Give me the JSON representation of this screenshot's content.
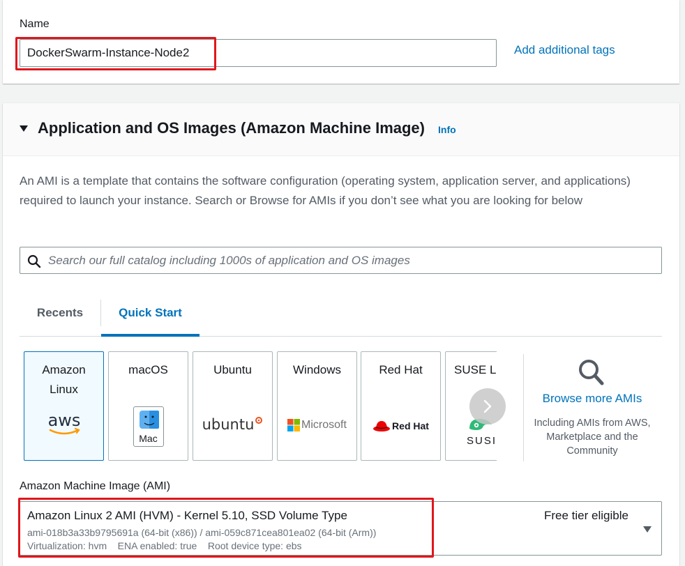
{
  "name_section": {
    "label": "Name",
    "input_value": "DockerSwarm-Instance-Node2",
    "add_tags_link": "Add additional tags"
  },
  "ami_section": {
    "title": "Application and OS Images (Amazon Machine Image)",
    "info_link": "Info",
    "description": "An AMI is a template that contains the software configuration (operating system, application server, and applications) required to launch your instance. Search or Browse for AMIs if you don’t see what you are looking for below",
    "search_placeholder": "Search our full catalog including 1000s of application and OS images",
    "tabs": [
      {
        "label": "Recents",
        "active": false
      },
      {
        "label": "Quick Start",
        "active": true
      }
    ],
    "os_tiles": [
      {
        "label": "Amazon Linux",
        "logo": "aws",
        "selected": true
      },
      {
        "label": "macOS",
        "logo": "Mac",
        "selected": false
      },
      {
        "label": "Ubuntu",
        "logo": "ubuntu",
        "selected": false
      },
      {
        "label": "Windows",
        "logo": "Microsoft",
        "selected": false
      },
      {
        "label": "Red Hat",
        "logo": "Red Hat",
        "selected": false
      },
      {
        "label": "SUSE Li",
        "logo": "SUSI",
        "selected": false
      }
    ],
    "browse": {
      "link": "Browse more AMIs",
      "subtext": "Including AMIs from AWS, Marketplace and the Community"
    },
    "ami_select": {
      "label": "Amazon Machine Image (AMI)",
      "name": "Amazon Linux 2 AMI (HVM) - Kernel 5.10, SSD Volume Type",
      "ids": "ami-018b3a33b9795691a (64-bit (x86)) / ami-059c871cea801ea02 (64-bit (Arm))",
      "meta": "Virtualization: hvm    ENA enabled: true    Root device type: ebs",
      "badge": "Free tier eligible"
    }
  },
  "colors": {
    "link": "#0073bb",
    "highlight": "#e0161c",
    "selected_tile_bg": "#f1faff"
  }
}
